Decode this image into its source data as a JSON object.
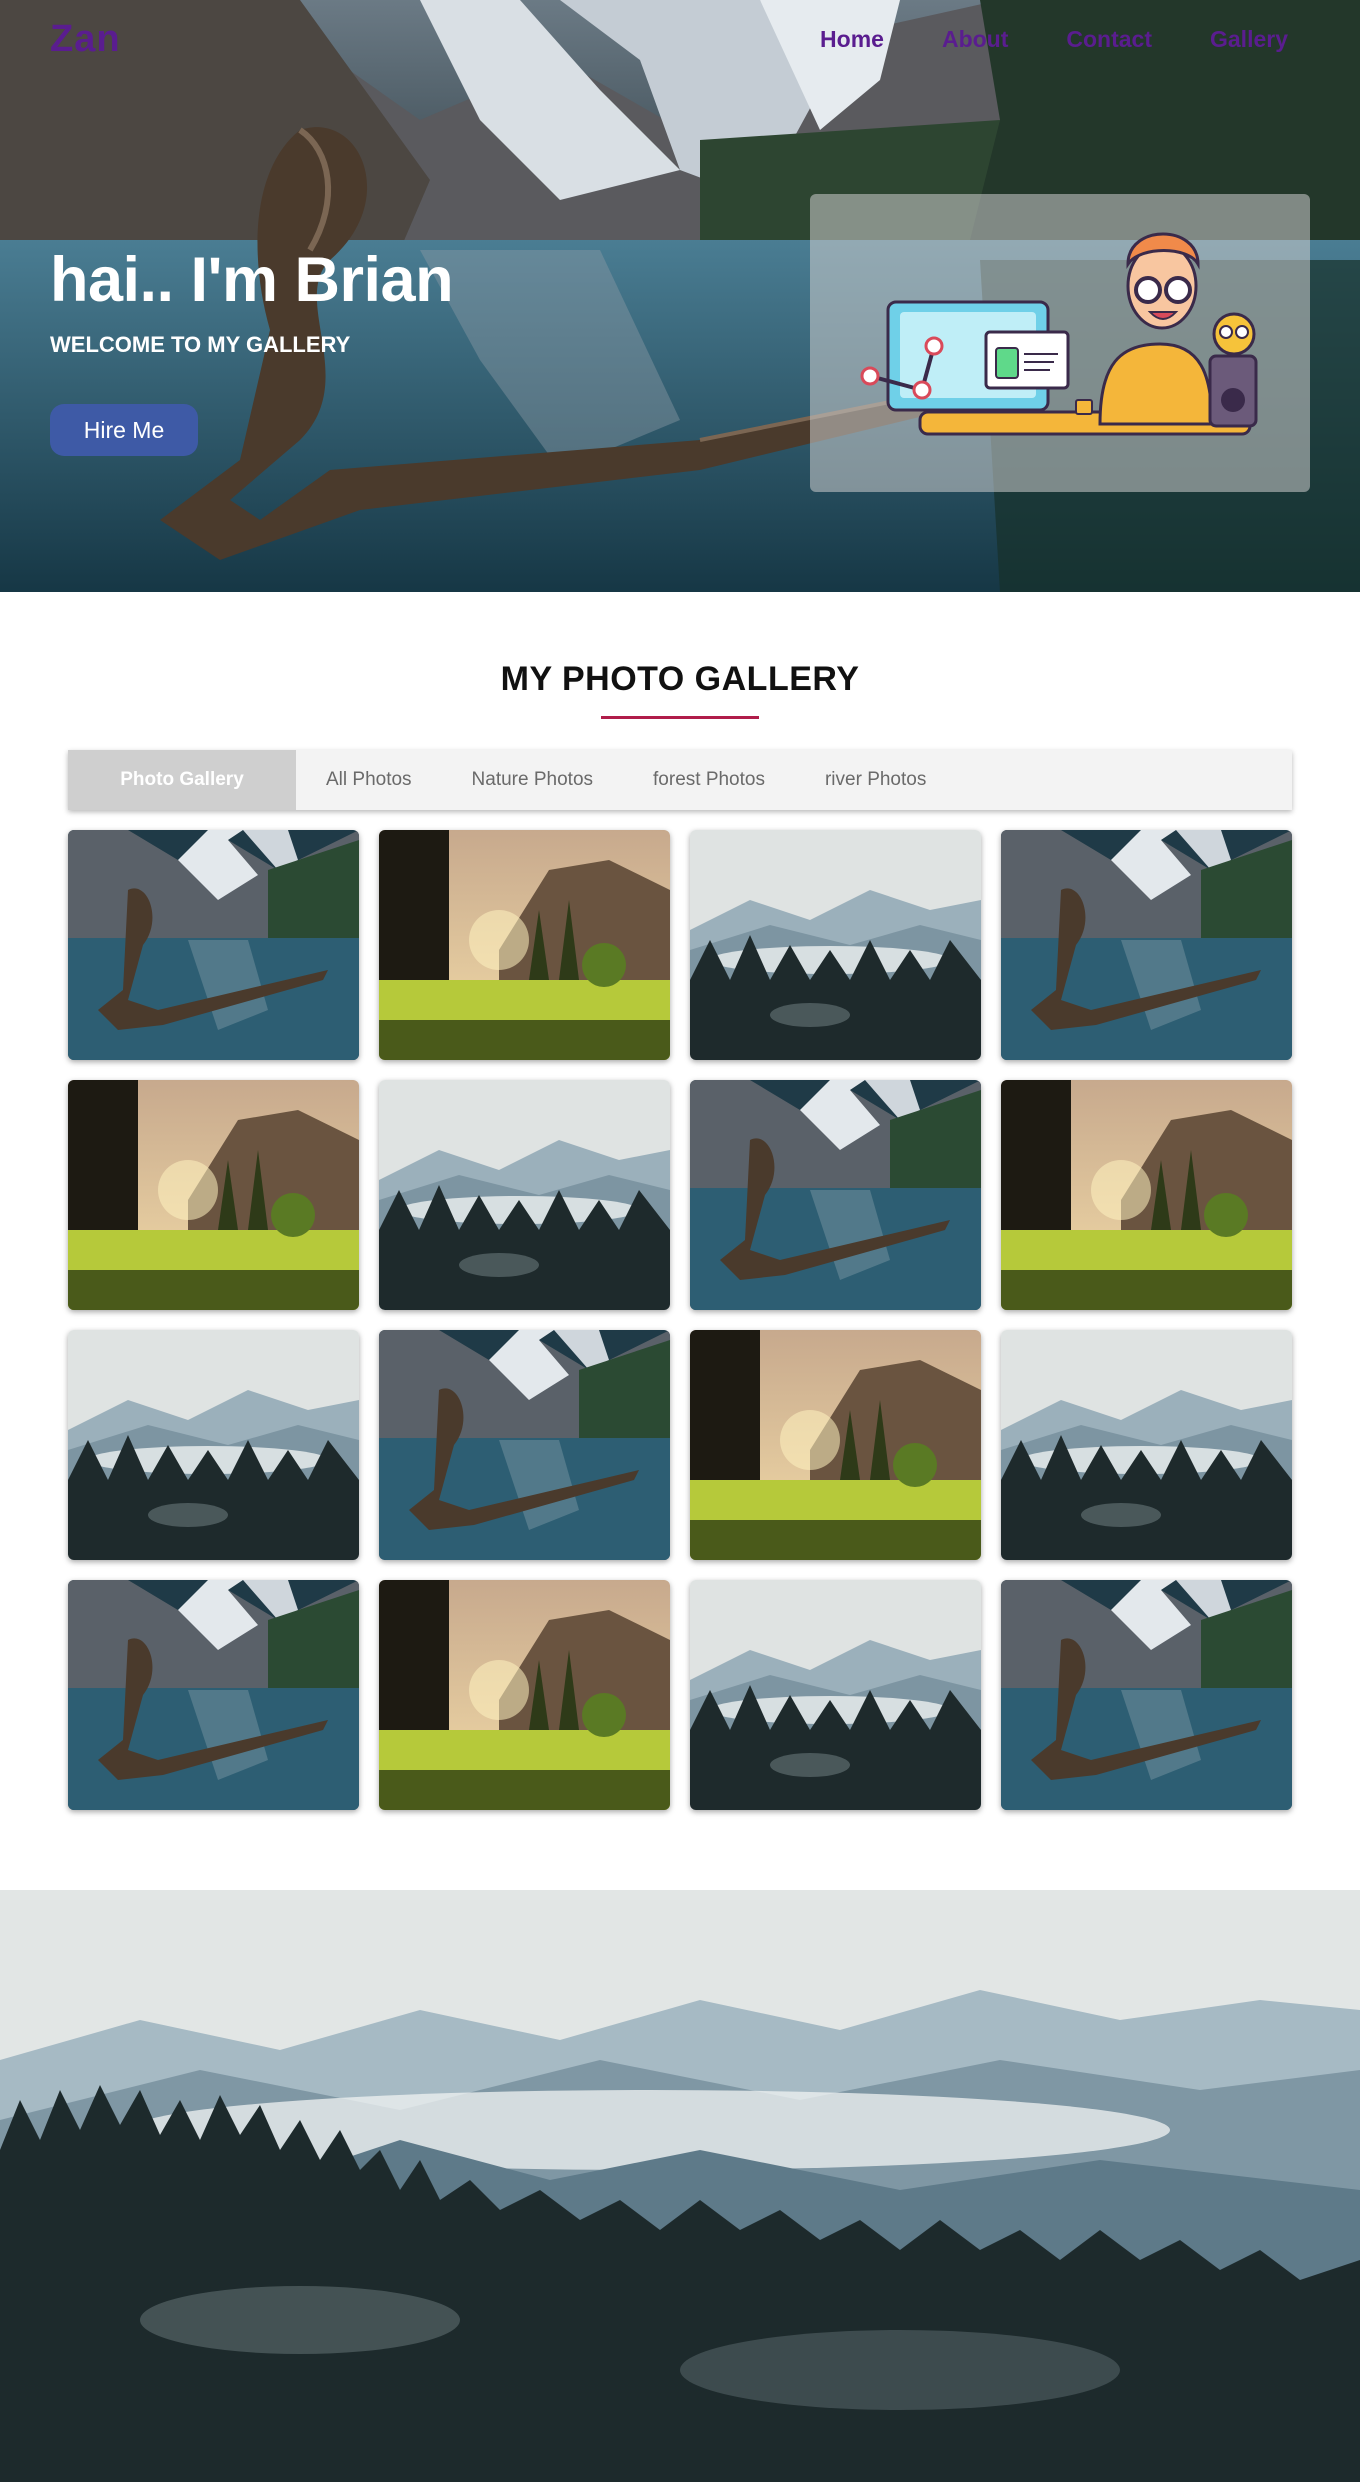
{
  "nav": {
    "logo": "Zan",
    "links": [
      "Home",
      "About",
      "Contact",
      "Gallery"
    ]
  },
  "hero": {
    "title": "hai.. I'm Brian",
    "subtitle": "WELCOME TO MY GALLERY",
    "cta_label": "Hire Me",
    "illustration": "developer-at-desk-illustration"
  },
  "gallery": {
    "title": "MY PHOTO GALLERY",
    "tabs": [
      "Photo Gallery",
      "All Photos",
      "Nature Photos",
      "forest Photos",
      "river Photos"
    ],
    "active_tab": "Photo Gallery",
    "photos": [
      "lake",
      "forest-sunset",
      "misty-mountains",
      "lake",
      "forest-sunset",
      "misty-mountains",
      "lake",
      "forest-sunset",
      "misty-mountains",
      "lake",
      "forest-sunset",
      "misty-mountains",
      "lake",
      "forest-sunset",
      "misty-mountains",
      "lake"
    ]
  },
  "banner": {
    "photo": "misty-mountains"
  },
  "colors": {
    "brand": "#5a1d8f",
    "button": "#3e5aa6",
    "accent_underline": "#b01d4a",
    "tab_bar": "#f3f3f3",
    "tab_active": "#cfcfcf"
  }
}
